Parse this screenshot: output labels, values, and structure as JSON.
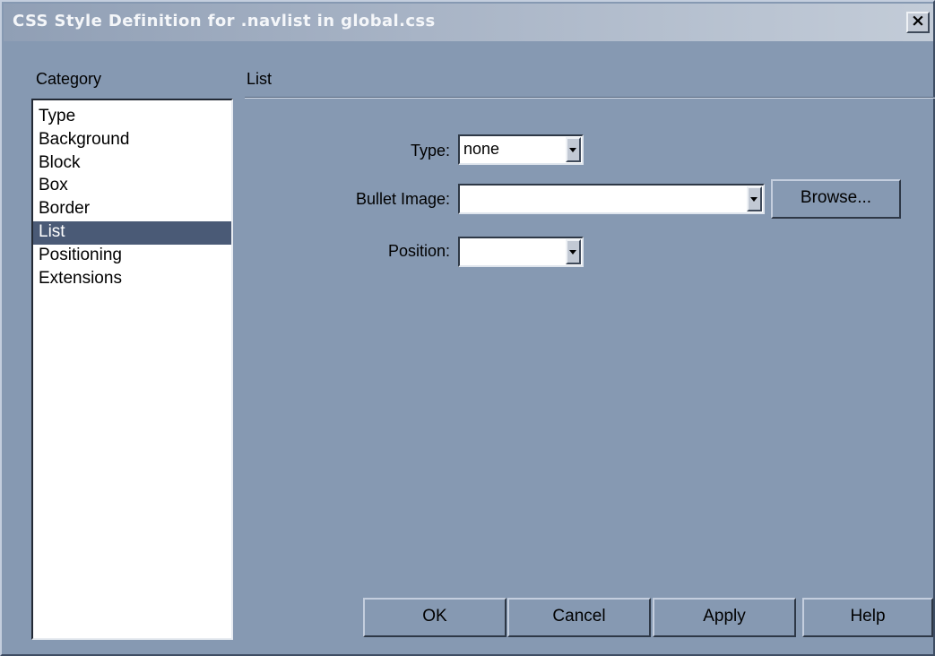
{
  "window": {
    "title": "CSS Style Definition for .navlist in global.css",
    "close_glyph": "✕"
  },
  "category": {
    "label": "Category",
    "items": [
      {
        "label": "Type"
      },
      {
        "label": "Background"
      },
      {
        "label": "Block"
      },
      {
        "label": "Box"
      },
      {
        "label": "Border"
      },
      {
        "label": "List"
      },
      {
        "label": "Positioning"
      },
      {
        "label": "Extensions"
      }
    ],
    "selected": "List"
  },
  "panel": {
    "title": "List",
    "type": {
      "label": "Type:",
      "value": "none"
    },
    "bullet_image": {
      "label": "Bullet Image:",
      "value": ""
    },
    "position": {
      "label": "Position:",
      "value": ""
    },
    "browse_label": "Browse..."
  },
  "buttons": {
    "ok": "OK",
    "cancel": "Cancel",
    "apply": "Apply",
    "help": "Help"
  },
  "colors": {
    "dialog_bg": "#8699b2",
    "selection_bg": "#4a5a76"
  }
}
